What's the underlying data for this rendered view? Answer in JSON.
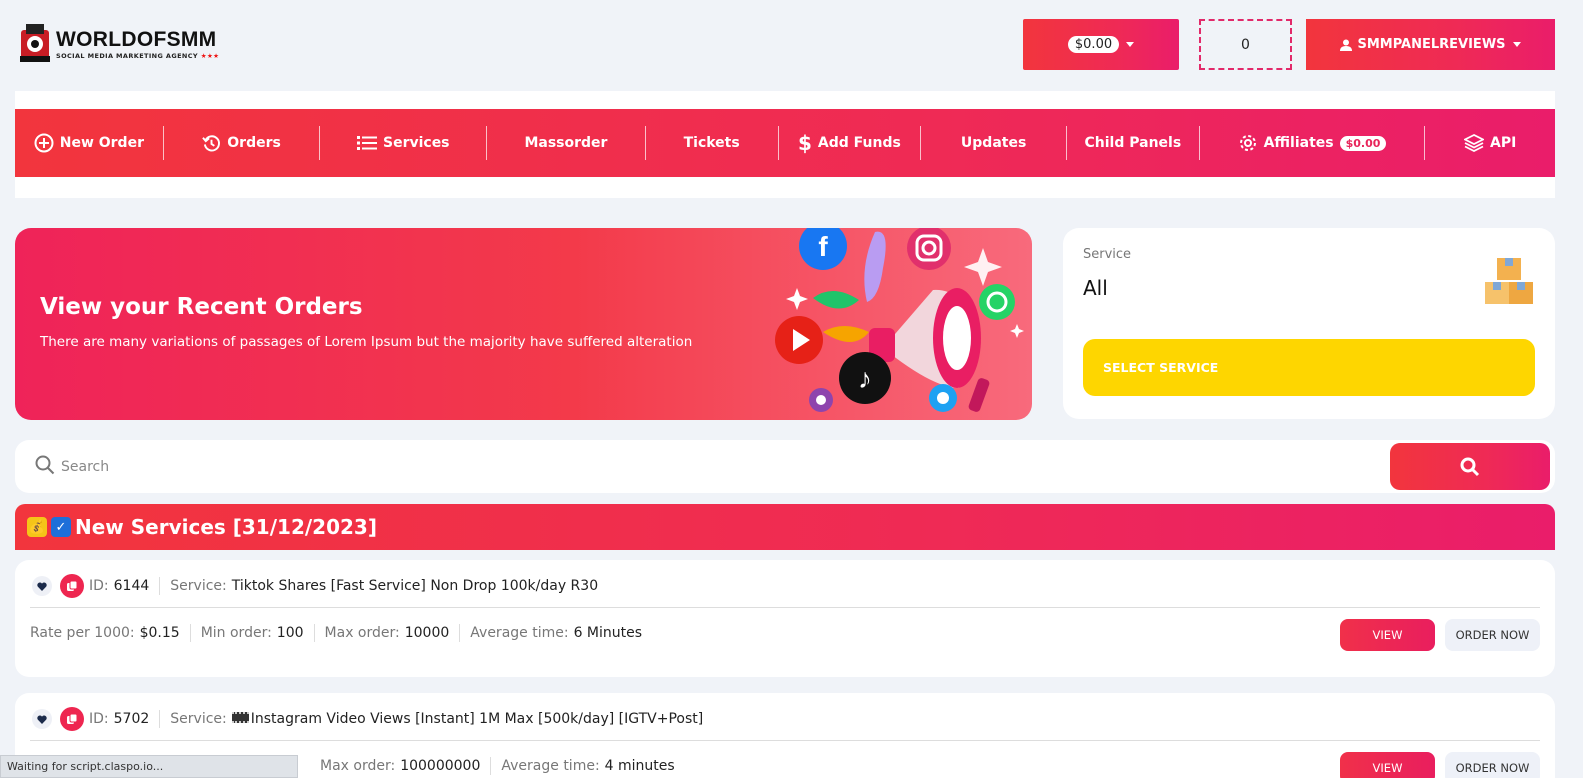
{
  "brand": {
    "name": "WORLDOFSMM",
    "tagline": "SOCIAL MEDIA MARKETING AGENCY",
    "tagline_stars": "★★★"
  },
  "header": {
    "balance": "$0.00",
    "counter": "0",
    "username": "SMMPANELREVIEWS"
  },
  "nav": {
    "items": [
      {
        "label": "New Order",
        "icon": "plus-circle-icon"
      },
      {
        "label": "Orders",
        "icon": "history-icon"
      },
      {
        "label": "Services",
        "icon": "list-icon"
      },
      {
        "label": "Massorder"
      },
      {
        "label": "Tickets"
      },
      {
        "label": "Add Funds",
        "icon": "dollar-icon"
      },
      {
        "label": "Updates"
      },
      {
        "label": "Child Panels"
      },
      {
        "label": "Affiliates",
        "icon": "gear-icon",
        "badge": "$0.00"
      },
      {
        "label": "API",
        "icon": "layers-icon"
      }
    ]
  },
  "hero": {
    "title": "View your Recent Orders",
    "subtitle": "There are many variations of passages of Lorem Ipsum but the majority have suffered alteration"
  },
  "service_filter": {
    "label": "Service",
    "value": "All",
    "button": "SELECT SERVICE"
  },
  "search": {
    "placeholder": "Search"
  },
  "category": {
    "title": "New Services [31/12/2023]",
    "emoji_1": "💰",
    "emoji_2": "✓"
  },
  "labels": {
    "id": "ID:",
    "service": "Service:",
    "rate": "Rate per 1000:",
    "min": "Min order:",
    "max": "Max order:",
    "avg": "Average time:",
    "view": "VIEW",
    "order_now": "ORDER NOW"
  },
  "services": [
    {
      "id": "6144",
      "name": "Tiktok Shares [Fast Service] Non Drop 100k/day R30",
      "rate": "$0.15",
      "min": "100",
      "max": "10000",
      "avg": "6 Minutes"
    },
    {
      "id": "5702",
      "name": "Instagram Video Views [Instant] 1M Max [500k/day] [IGTV+Post]",
      "max": "100000000",
      "avg": "4 minutes"
    }
  ],
  "status_bar": "Waiting for script.claspo.io...",
  "colors": {
    "accent_start": "#f2353d",
    "accent_end": "#ea1d6a",
    "select_button": "#fed600"
  }
}
